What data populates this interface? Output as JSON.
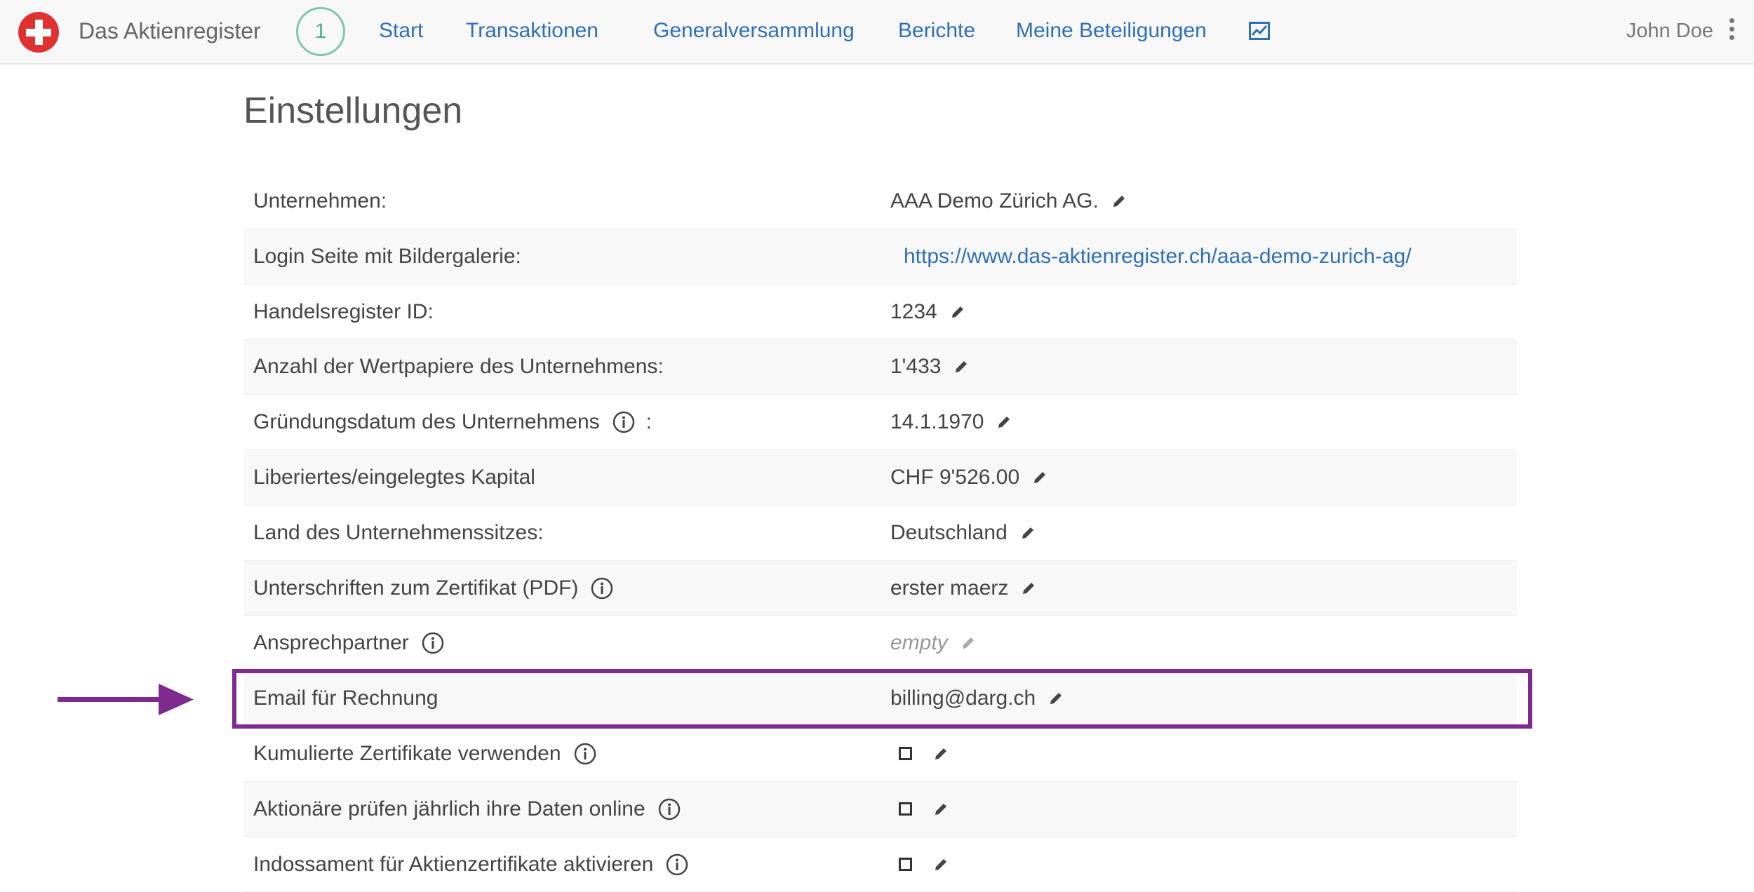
{
  "navbar": {
    "brand": "Das Aktienregister",
    "step_badge": "1",
    "links": [
      "Start",
      "Transaktionen",
      "Generalversammlung",
      "Berichte",
      "Meine Beteiligungen"
    ],
    "stats_icon": "chart-line-icon",
    "user": "John Doe"
  },
  "page": {
    "title": "Einstellungen"
  },
  "settings": {
    "rows": [
      {
        "label": "Unternehmen:",
        "value": "AAA Demo Zürich AG."
      },
      {
        "label": "Login Seite mit Bildergalerie:",
        "value": "https://www.das-aktienregister.ch/aaa-demo-zurich-ag/"
      },
      {
        "label": "Handelsregister ID:",
        "value": "1234"
      },
      {
        "label": "Anzahl der Wertpapiere des Unternehmens:",
        "value": "1'433"
      },
      {
        "label": "Gründungsdatum des Unternehmens",
        "suffix": ":",
        "value": "14.1.1970"
      },
      {
        "label": "Liberiertes/eingelegtes Kapital",
        "value": "CHF 9'526.00"
      },
      {
        "label": "Land des Unternehmenssitzes:",
        "value": "Deutschland"
      },
      {
        "label": "Unterschriften zum Zertifikat (PDF)",
        "value": "erster maerz"
      },
      {
        "label": "Ansprechpartner",
        "value": "empty"
      },
      {
        "label": "Email für Rechnung",
        "value": "billing@darg.ch"
      },
      {
        "label": "Kumulierte Zertifikate verwenden",
        "checked": false
      },
      {
        "label": "Aktionäre prüfen jährlich ihre Daten online",
        "checked": false
      },
      {
        "label": "Indossament für Aktienzertifikate aktivieren",
        "checked": false
      }
    ]
  },
  "colors": {
    "link": "#2f6fb7",
    "highlight": "#7e2a8e",
    "logo": "#e03131",
    "step_ring": "#7ec8a9"
  }
}
